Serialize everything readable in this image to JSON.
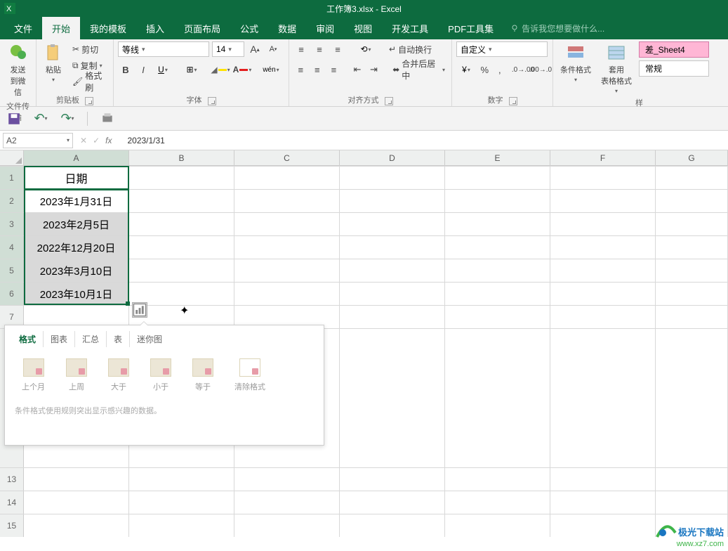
{
  "title": "工作簿3.xlsx - Excel",
  "menu": {
    "tabs": [
      "文件",
      "开始",
      "我的模板",
      "插入",
      "页面布局",
      "公式",
      "数据",
      "审阅",
      "视图",
      "开发工具",
      "PDF工具集"
    ],
    "active": 1,
    "tell": "告诉我您想要做什么..."
  },
  "ribbon": {
    "send": {
      "label": "发送\n到微信",
      "group": "文件传输"
    },
    "clipboard": {
      "paste": "粘贴",
      "cut": "剪切",
      "copy": "复制",
      "format": "格式刷",
      "group": "剪贴板"
    },
    "font": {
      "name": "等线",
      "size": "14",
      "bold": "B",
      "italic": "I",
      "underline": "U",
      "group": "字体",
      "pinyin": "wén"
    },
    "align": {
      "wrap": "自动换行",
      "merge": "合并后居中",
      "group": "对齐方式"
    },
    "number": {
      "format": "自定义",
      "group": "数字"
    },
    "styles": {
      "cond": "条件格式",
      "table": "套用\n表格格式",
      "bad": "差_Sheet4",
      "normal": "常规",
      "group": "样"
    }
  },
  "namebox": "A2",
  "formula": "2023/1/31",
  "columns": [
    "A",
    "B",
    "C",
    "D",
    "E",
    "F",
    "G"
  ],
  "rows": {
    "header": "日期",
    "data": [
      "2023年1月31日",
      "2023年2月5日",
      "2022年12月20日",
      "2023年3月10日",
      "2023年10月1日"
    ]
  },
  "popup": {
    "tabs": [
      "格式",
      "图表",
      "汇总",
      "表",
      "迷你图"
    ],
    "active": 0,
    "items": [
      "上个月",
      "上周",
      "大于",
      "小于",
      "等于",
      "清除格式"
    ],
    "desc": "条件格式使用规则突出显示感兴趣的数据。"
  },
  "watermark": {
    "line1": "极光下载站",
    "line2": "www.xz7.com"
  }
}
